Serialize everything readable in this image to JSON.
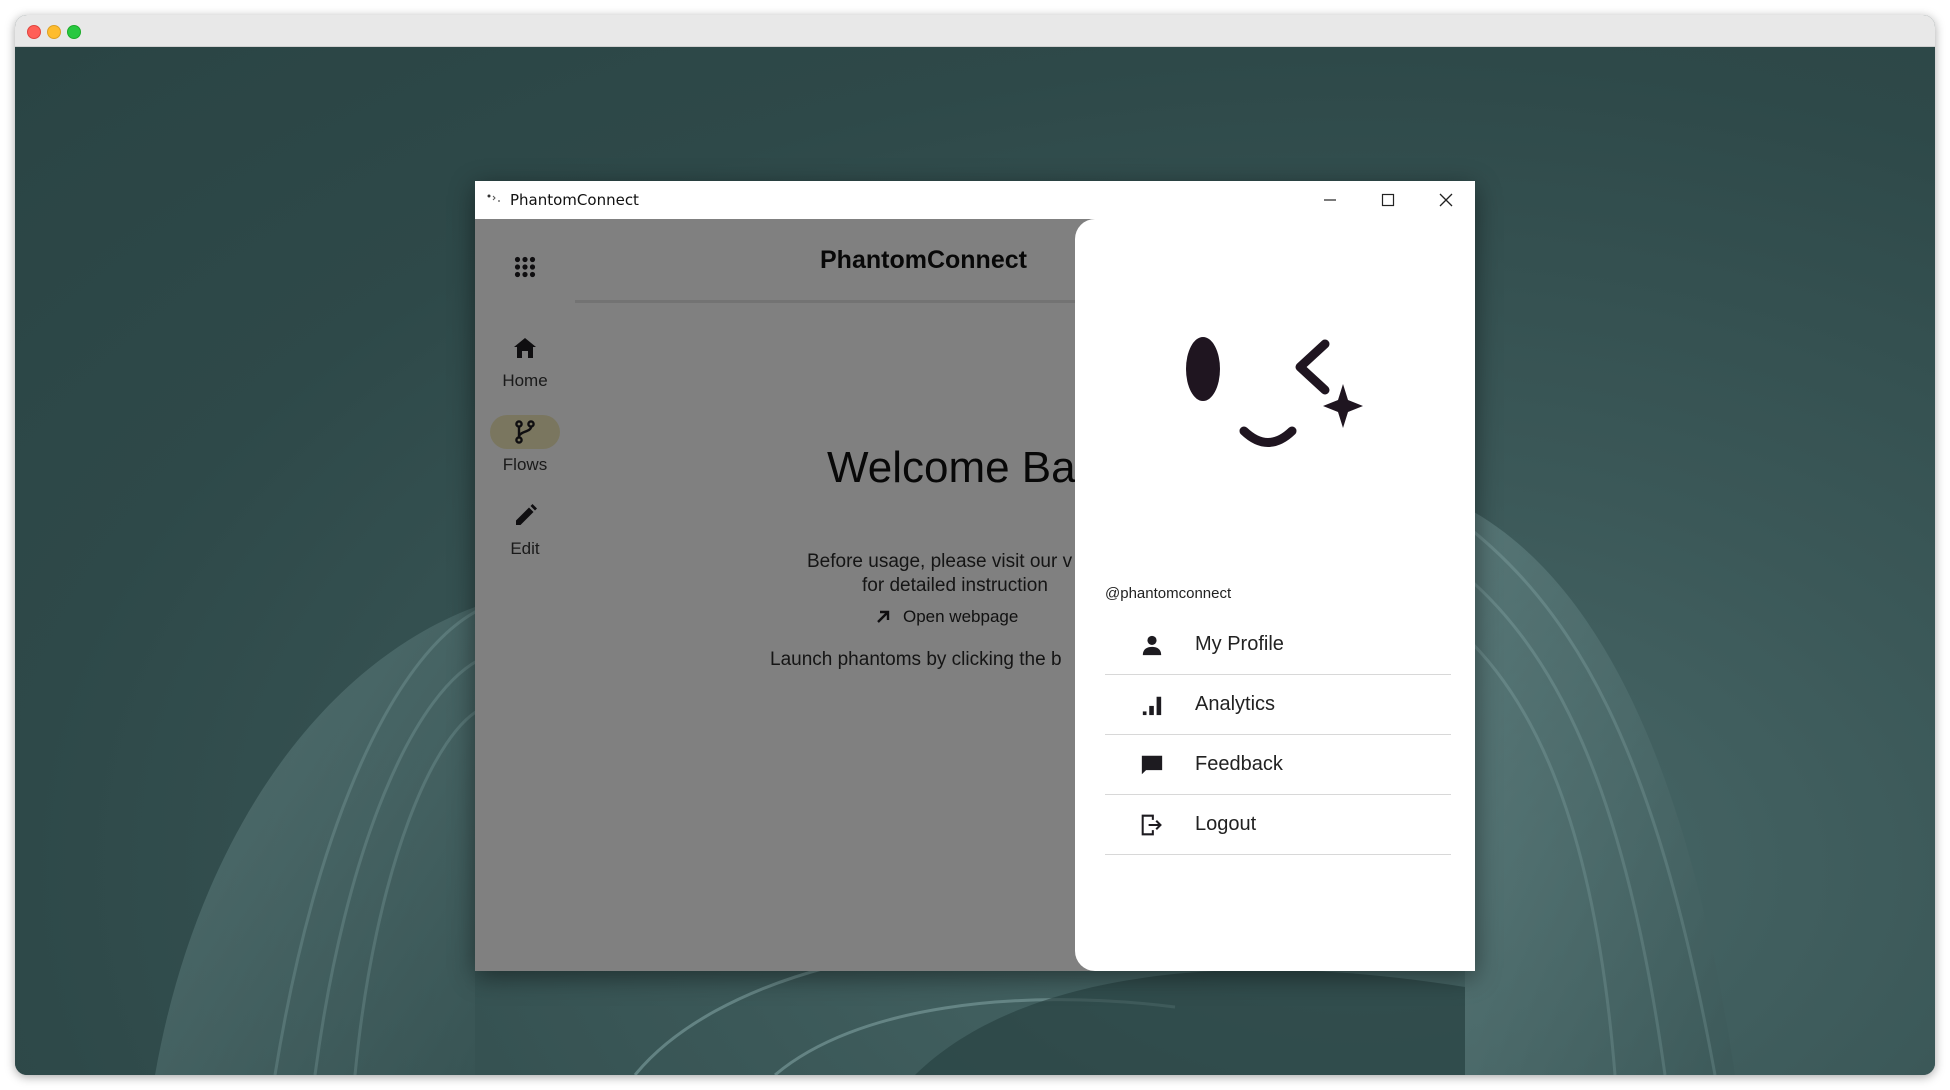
{
  "app": {
    "window_title": "PhantomConnect",
    "header_title": "PhantomConnect"
  },
  "rail": {
    "items": [
      {
        "label": "Home",
        "icon": "home-icon",
        "active": false
      },
      {
        "label": "Flows",
        "icon": "fork-icon",
        "active": true
      },
      {
        "label": "Edit",
        "icon": "pencil-icon",
        "active": false
      }
    ]
  },
  "main": {
    "welcome": "Welcome Bac",
    "intro_line1": "Before usage, please visit our v",
    "intro_line2": "for detailed instruction",
    "open_link": "Open webpage",
    "launch_text": "Launch phantoms by clicking the b"
  },
  "drawer": {
    "handle": "@phantomconnect",
    "items": [
      {
        "label": "My Profile",
        "icon": "person-icon"
      },
      {
        "label": "Analytics",
        "icon": "bar-chart-icon"
      },
      {
        "label": "Feedback",
        "icon": "chat-icon"
      },
      {
        "label": "Logout",
        "icon": "logout-icon"
      }
    ]
  },
  "colors": {
    "rail_active_pill": "#eae3b6",
    "desktop": "#2f4a4a"
  }
}
